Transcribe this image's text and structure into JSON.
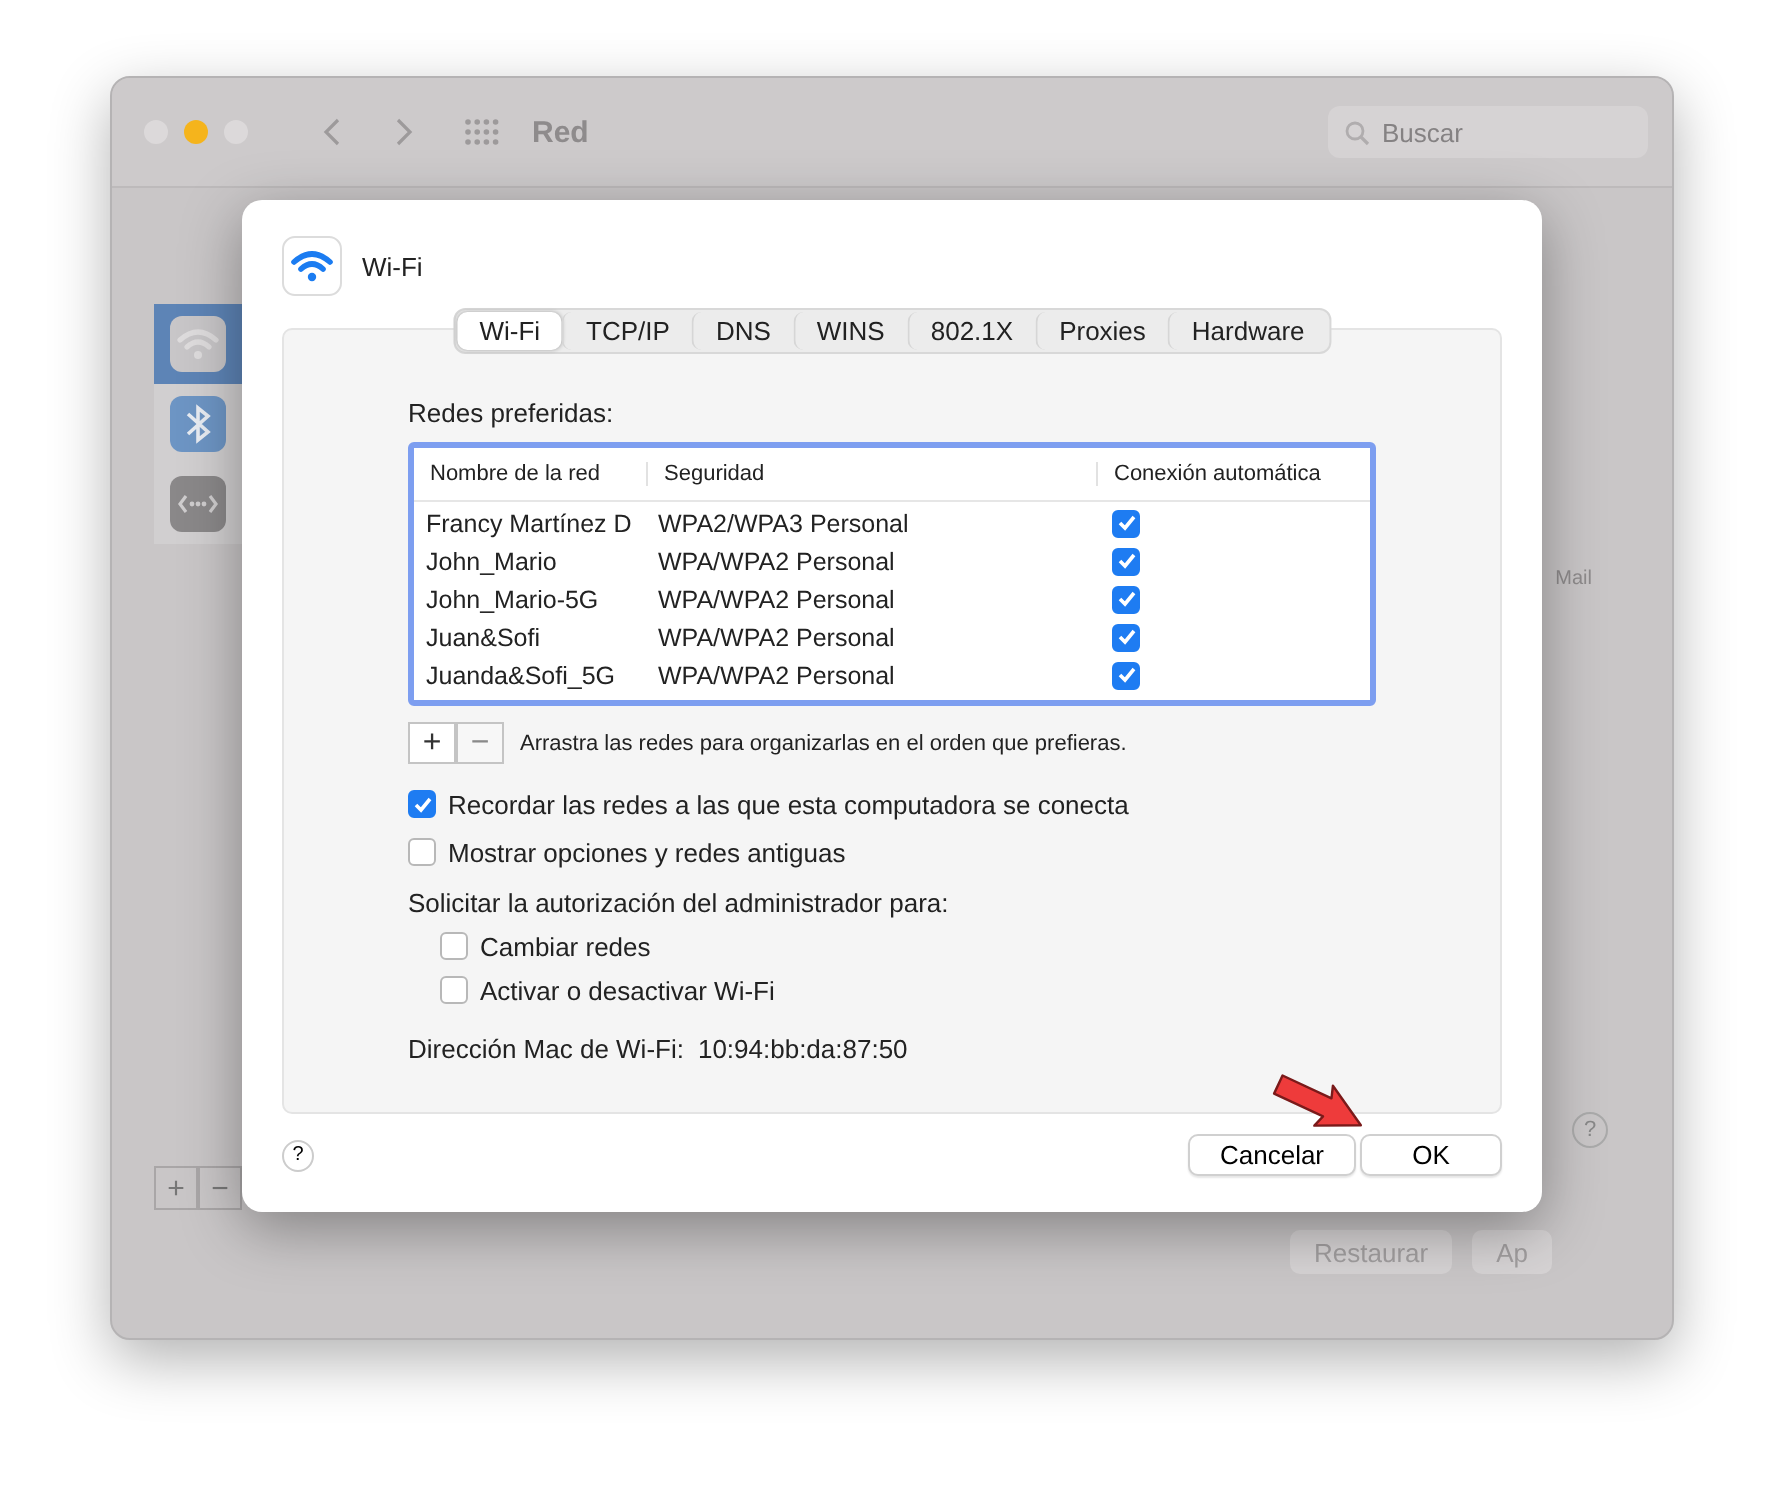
{
  "window": {
    "title": "Red",
    "traffic_lights": [
      {
        "color": "#dcd9da"
      },
      {
        "color": "#f5b41c"
      },
      {
        "color": "#dcd9da"
      }
    ]
  },
  "search": {
    "placeholder": "Buscar"
  },
  "sidebar": {
    "items": [
      {
        "kind": "wifi",
        "selected": true
      },
      {
        "kind": "bluetooth",
        "selected": false
      },
      {
        "kind": "other",
        "selected": false
      }
    ]
  },
  "background": {
    "side_text": "Mail",
    "list_buttons": [
      "+",
      "−"
    ],
    "help": "?",
    "buttons": [
      "Restaurar",
      "Ap"
    ]
  },
  "dialog": {
    "title": "Wi-Fi",
    "tabs": [
      {
        "label": "Wi-Fi",
        "selected": true
      },
      {
        "label": "TCP/IP",
        "selected": false
      },
      {
        "label": "DNS",
        "selected": false
      },
      {
        "label": "WINS",
        "selected": false
      },
      {
        "label": "802.1X",
        "selected": false
      },
      {
        "label": "Proxies",
        "selected": false
      },
      {
        "label": "Hardware",
        "selected": false
      }
    ],
    "list_label": "Redes preferidas:",
    "table": {
      "columns": [
        "Nombre de la red",
        "Seguridad",
        "Conexión automática"
      ],
      "rows": [
        {
          "name": "Francy Martínez D",
          "security": "WPA2/WPA3 Personal",
          "auto": true
        },
        {
          "name": "John_Mario",
          "security": "WPA/WPA2 Personal",
          "auto": true
        },
        {
          "name": "John_Mario-5G",
          "security": "WPA/WPA2 Personal",
          "auto": true
        },
        {
          "name": "Juan&Sofi",
          "security": "WPA/WPA2 Personal",
          "auto": true
        },
        {
          "name": "Juanda&Sofi_5G",
          "security": "WPA/WPA2 Personal",
          "auto": true
        }
      ]
    },
    "list_buttons": [
      {
        "label": "+",
        "disabled": false
      },
      {
        "label": "−",
        "disabled": true
      }
    ],
    "hint": "Arrastra las redes para organizarlas en el orden que prefieras.",
    "options": [
      {
        "label": "Recordar las redes a las que esta computadora se conecta",
        "checked": true
      },
      {
        "label": "Mostrar opciones y redes antiguas",
        "checked": false
      }
    ],
    "admin": {
      "label": "Solicitar la autorización del administrador para:",
      "options": [
        {
          "label": "Cambiar redes",
          "checked": false
        },
        {
          "label": "Activar o desactivar Wi-Fi",
          "checked": false
        }
      ]
    },
    "mac": {
      "label": "Dirección Mac de Wi-Fi:",
      "value": "10:94:bb:da:87:50"
    },
    "help": "?",
    "buttons": [
      "Cancelar",
      "OK"
    ]
  }
}
